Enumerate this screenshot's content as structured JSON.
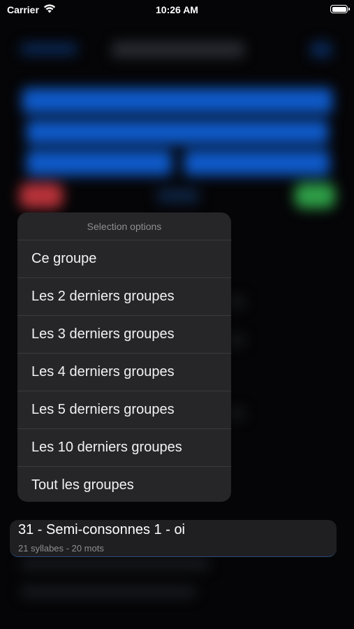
{
  "status_bar": {
    "carrier": "Carrier",
    "time": "10:26 AM"
  },
  "context_menu": {
    "header": "Selection options",
    "items": [
      {
        "label": "Ce groupe"
      },
      {
        "label": "Les 2 derniers groupes"
      },
      {
        "label": "Les 3 derniers groupes"
      },
      {
        "label": "Les 4 derniers groupes"
      },
      {
        "label": "Les 5 derniers groupes"
      },
      {
        "label": "Les 10 derniers groupes"
      },
      {
        "label": "Tout les groupes"
      }
    ]
  },
  "preview_card": {
    "title": "31 - Semi-consonnes 1 - oi",
    "subtitle": "21 syllabes - 20 mots"
  },
  "colors": {
    "background": "#050507",
    "menu_background": "#262629",
    "blurred_primary": "#0f5ac9",
    "blurred_red": "#b8333a",
    "blurred_green": "#2e9e47"
  }
}
